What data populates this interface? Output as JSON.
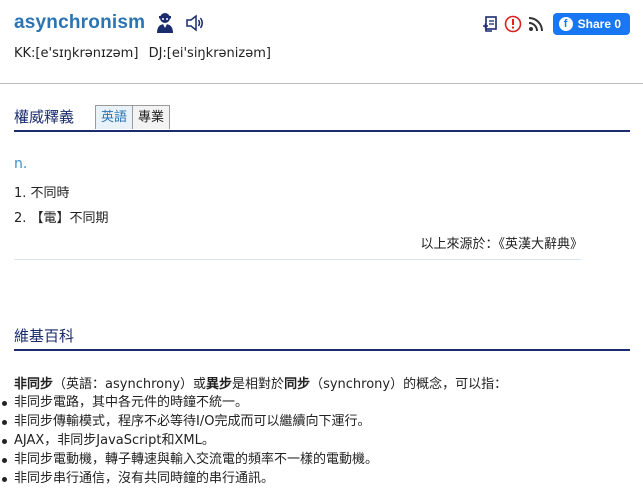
{
  "entry": {
    "word": "asynchronism",
    "kk": "KK:[e'sɪŋkrənɪzəm]",
    "dj": "DJ:[ei'siŋkrənizəm]"
  },
  "toolbar": {
    "share_label": "Share 0",
    "fb_letter": "f"
  },
  "authority": {
    "title": "權威釋義",
    "tabs": [
      {
        "label": "英語",
        "active": true
      },
      {
        "label": "專業",
        "active": false
      }
    ],
    "pos": "n.",
    "definitions": [
      "1. 不同時",
      "2. 【電】不同期"
    ],
    "source": "以上來源於：《英漢大辭典》"
  },
  "wiki": {
    "title": "維基百科",
    "intro_parts": [
      {
        "text": "非同步",
        "bold": true
      },
      {
        "text": "（英語：asynchrony）或",
        "bold": false
      },
      {
        "text": "異步",
        "bold": true
      },
      {
        "text": "是相對於",
        "bold": false
      },
      {
        "text": "同步",
        "bold": true
      },
      {
        "text": "（synchrony）的概念，可以指：",
        "bold": false
      }
    ],
    "bullets": [
      "非同步電路，其中各元件的時鐘不統一。",
      "非同步傳輸模式，程序不必等待I/O完成而可以繼續向下運行。",
      "AJAX，非同步JavaScript和XML。",
      "非同步電動機，轉子轉速與輸入交流電的頻率不一樣的電動機。",
      "非同步串行通信，沒有共同時鐘的串行通訊。"
    ]
  },
  "colors": {
    "accent_blue": "#2a74b4",
    "heading_navy": "#1a2b6e",
    "facebook": "#1877f2",
    "alert_red": "#e02020"
  },
  "icons": [
    "user-icon",
    "speaker-icon",
    "notebook-add-icon",
    "alert-icon",
    "rss-icon",
    "facebook-icon"
  ]
}
